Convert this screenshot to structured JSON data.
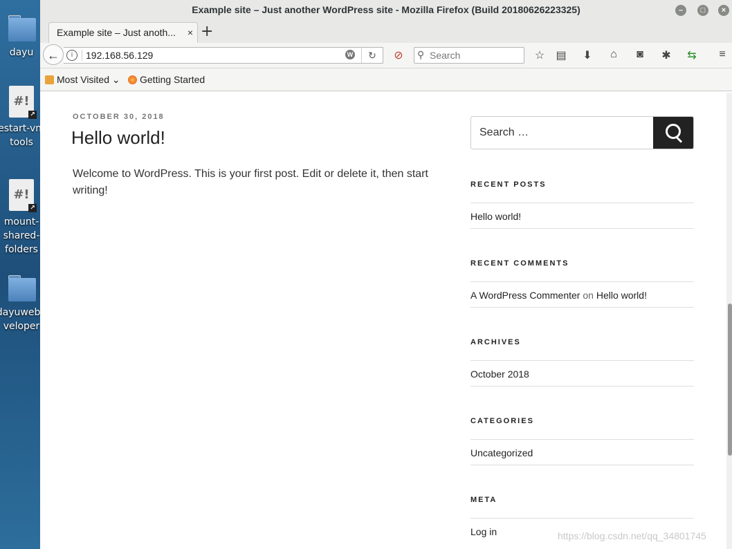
{
  "desktop": {
    "icons": [
      {
        "label": "dayu",
        "kind": "folder"
      },
      {
        "label": "estart-vm\ntools",
        "kind": "script"
      },
      {
        "label": "mount-\nshared-\nfolders",
        "kind": "script"
      },
      {
        "label": "dayuwebd\nveloper",
        "kind": "folder"
      }
    ]
  },
  "window": {
    "title": "Example site – Just another WordPress site - Mozilla Firefox (Build 20180626223325)",
    "controls": [
      "minimize",
      "maximize",
      "close"
    ]
  },
  "tab": {
    "title": "Example site – Just anoth...",
    "close": "×"
  },
  "newtab": "+",
  "navbar": {
    "url": "192.168.56.129",
    "search_placeholder": "Search",
    "icons": [
      "back-icon",
      "info-icon",
      "wordpress-icon",
      "reload-icon",
      "noscript-icon",
      "bookmark-star-icon",
      "reading-list-icon",
      "download-icon",
      "home-icon",
      "pocket-icon",
      "extension-icon",
      "sync-icon",
      "menu-icon"
    ]
  },
  "bookmarks": {
    "most_visited": "Most Visited",
    "getting_started": "Getting Started"
  },
  "post": {
    "date": "OCTOBER 30, 2018",
    "title": "Hello world!",
    "body": "Welcome to WordPress. This is your first post. Edit or delete it, then start writing!"
  },
  "sidebar": {
    "search_placeholder": "Search …",
    "recent_posts": {
      "heading": "RECENT POSTS",
      "items": [
        "Hello world!"
      ]
    },
    "recent_comments": {
      "heading": "RECENT COMMENTS",
      "author": "A WordPress Commenter",
      "on": "on",
      "post": "Hello world!"
    },
    "archives": {
      "heading": "ARCHIVES",
      "items": [
        "October 2018"
      ]
    },
    "categories": {
      "heading": "CATEGORIES",
      "items": [
        "Uncategorized"
      ]
    },
    "meta": {
      "heading": "META",
      "items": [
        "Log in"
      ]
    }
  },
  "watermark": "https://blog.csdn.net/qq_34801745"
}
